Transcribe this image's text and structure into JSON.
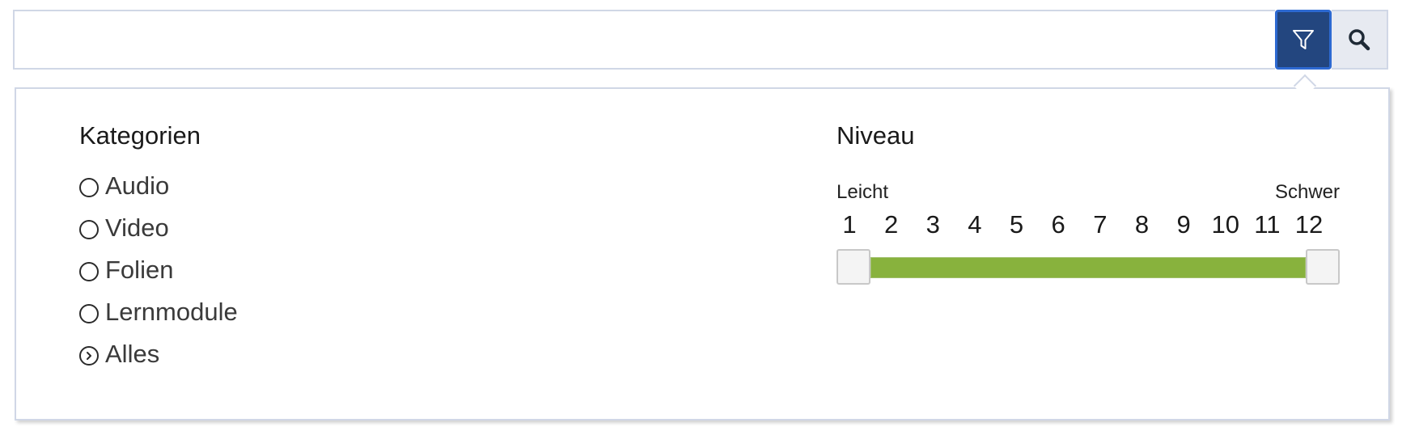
{
  "search": {
    "value": "",
    "placeholder": "",
    "filter_icon": "filter-icon",
    "search_icon": "magnifier-icon",
    "accent_color": "#23467f"
  },
  "filter_panel": {
    "categories": {
      "title": "Kategorien",
      "items": [
        {
          "label": "Audio",
          "selected": false
        },
        {
          "label": "Video",
          "selected": false
        },
        {
          "label": "Folien",
          "selected": false
        },
        {
          "label": "Lernmodule",
          "selected": false
        },
        {
          "label": "Alles",
          "selected": true
        }
      ]
    },
    "niveau": {
      "title": "Niveau",
      "min_label": "Leicht",
      "max_label": "Schwer",
      "ticks": [
        "1",
        "2",
        "3",
        "4",
        "5",
        "6",
        "7",
        "8",
        "9",
        "10",
        "11",
        "12"
      ],
      "range_min": 1,
      "range_max": 12,
      "selected_low": 1,
      "selected_high": 12,
      "track_color": "#88b23d"
    }
  }
}
